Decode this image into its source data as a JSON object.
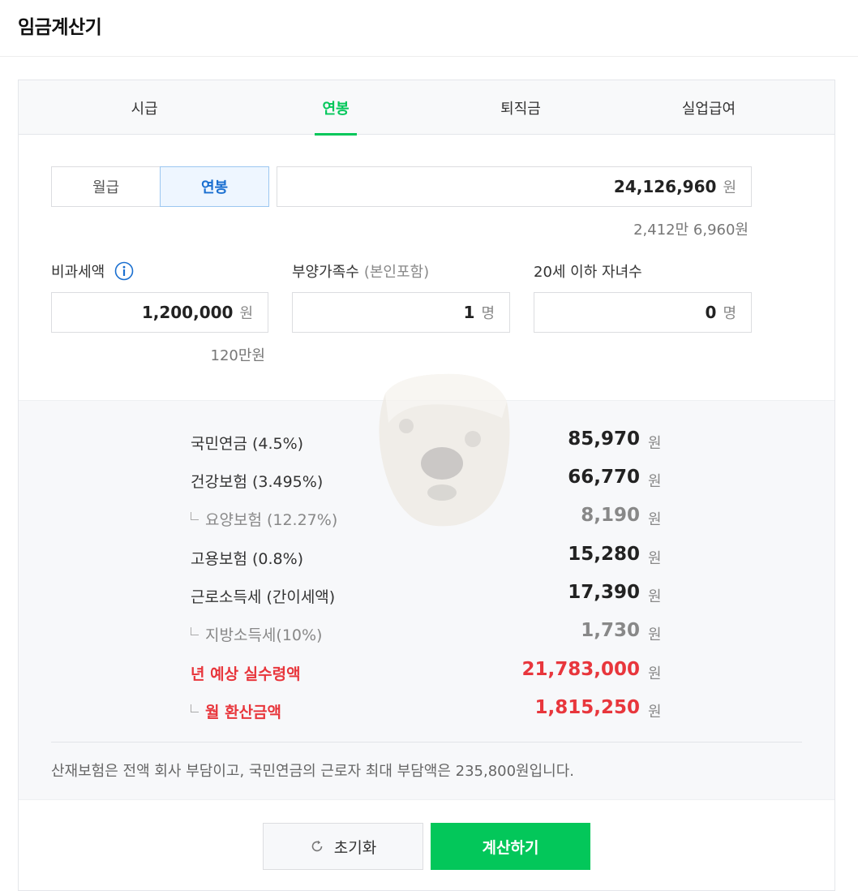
{
  "header": {
    "title": "임금계산기"
  },
  "tabs": [
    {
      "label": "시급"
    },
    {
      "label": "연봉"
    },
    {
      "label": "퇴직금"
    },
    {
      "label": "실업급여"
    }
  ],
  "active_tab": "연봉",
  "pay_type": {
    "options": [
      "월급",
      "연봉"
    ],
    "selected": "연봉"
  },
  "salary": {
    "value": "24,126,960",
    "unit": "원",
    "hint": "2,412만 6,960원"
  },
  "non_taxable": {
    "label": "비과세액",
    "value": "1,200,000",
    "unit": "원",
    "hint": "120만원",
    "icon": "info-icon"
  },
  "dependents": {
    "label": "부양가족수",
    "label_sub": "(본인포함)",
    "value": "1",
    "unit": "명"
  },
  "children": {
    "label": "20세 이하 자녀수",
    "value": "0",
    "unit": "명"
  },
  "results": [
    {
      "label": "국민연금 (4.5%)",
      "value": "85,970",
      "unit": "원"
    },
    {
      "label": "건강보험 (3.495%)",
      "value": "66,770",
      "unit": "원"
    },
    {
      "label": "요양보험 (12.27%)",
      "value": "8,190",
      "unit": "원"
    },
    {
      "label": "고용보험 (0.8%)",
      "value": "15,280",
      "unit": "원"
    },
    {
      "label": "근로소득세 (간이세액)",
      "value": "17,390",
      "unit": "원"
    },
    {
      "label": "지방소득세(10%)",
      "value": "1,730",
      "unit": "원"
    },
    {
      "label": "년 예상 실수령액",
      "value": "21,783,000",
      "unit": "원"
    },
    {
      "label": "월 환산금액",
      "value": "1,815,250",
      "unit": "원"
    }
  ],
  "note": "산재보험은 전액 회사 부담이고, 국민연금의 근로자 최대 부담액은 235,800원입니다.",
  "buttons": {
    "reset": "초기화",
    "calculate": "계산하기"
  },
  "colors": {
    "accent_green": "#03c75a",
    "red": "#e8363c",
    "selected_blue": "#1a6fd0"
  }
}
